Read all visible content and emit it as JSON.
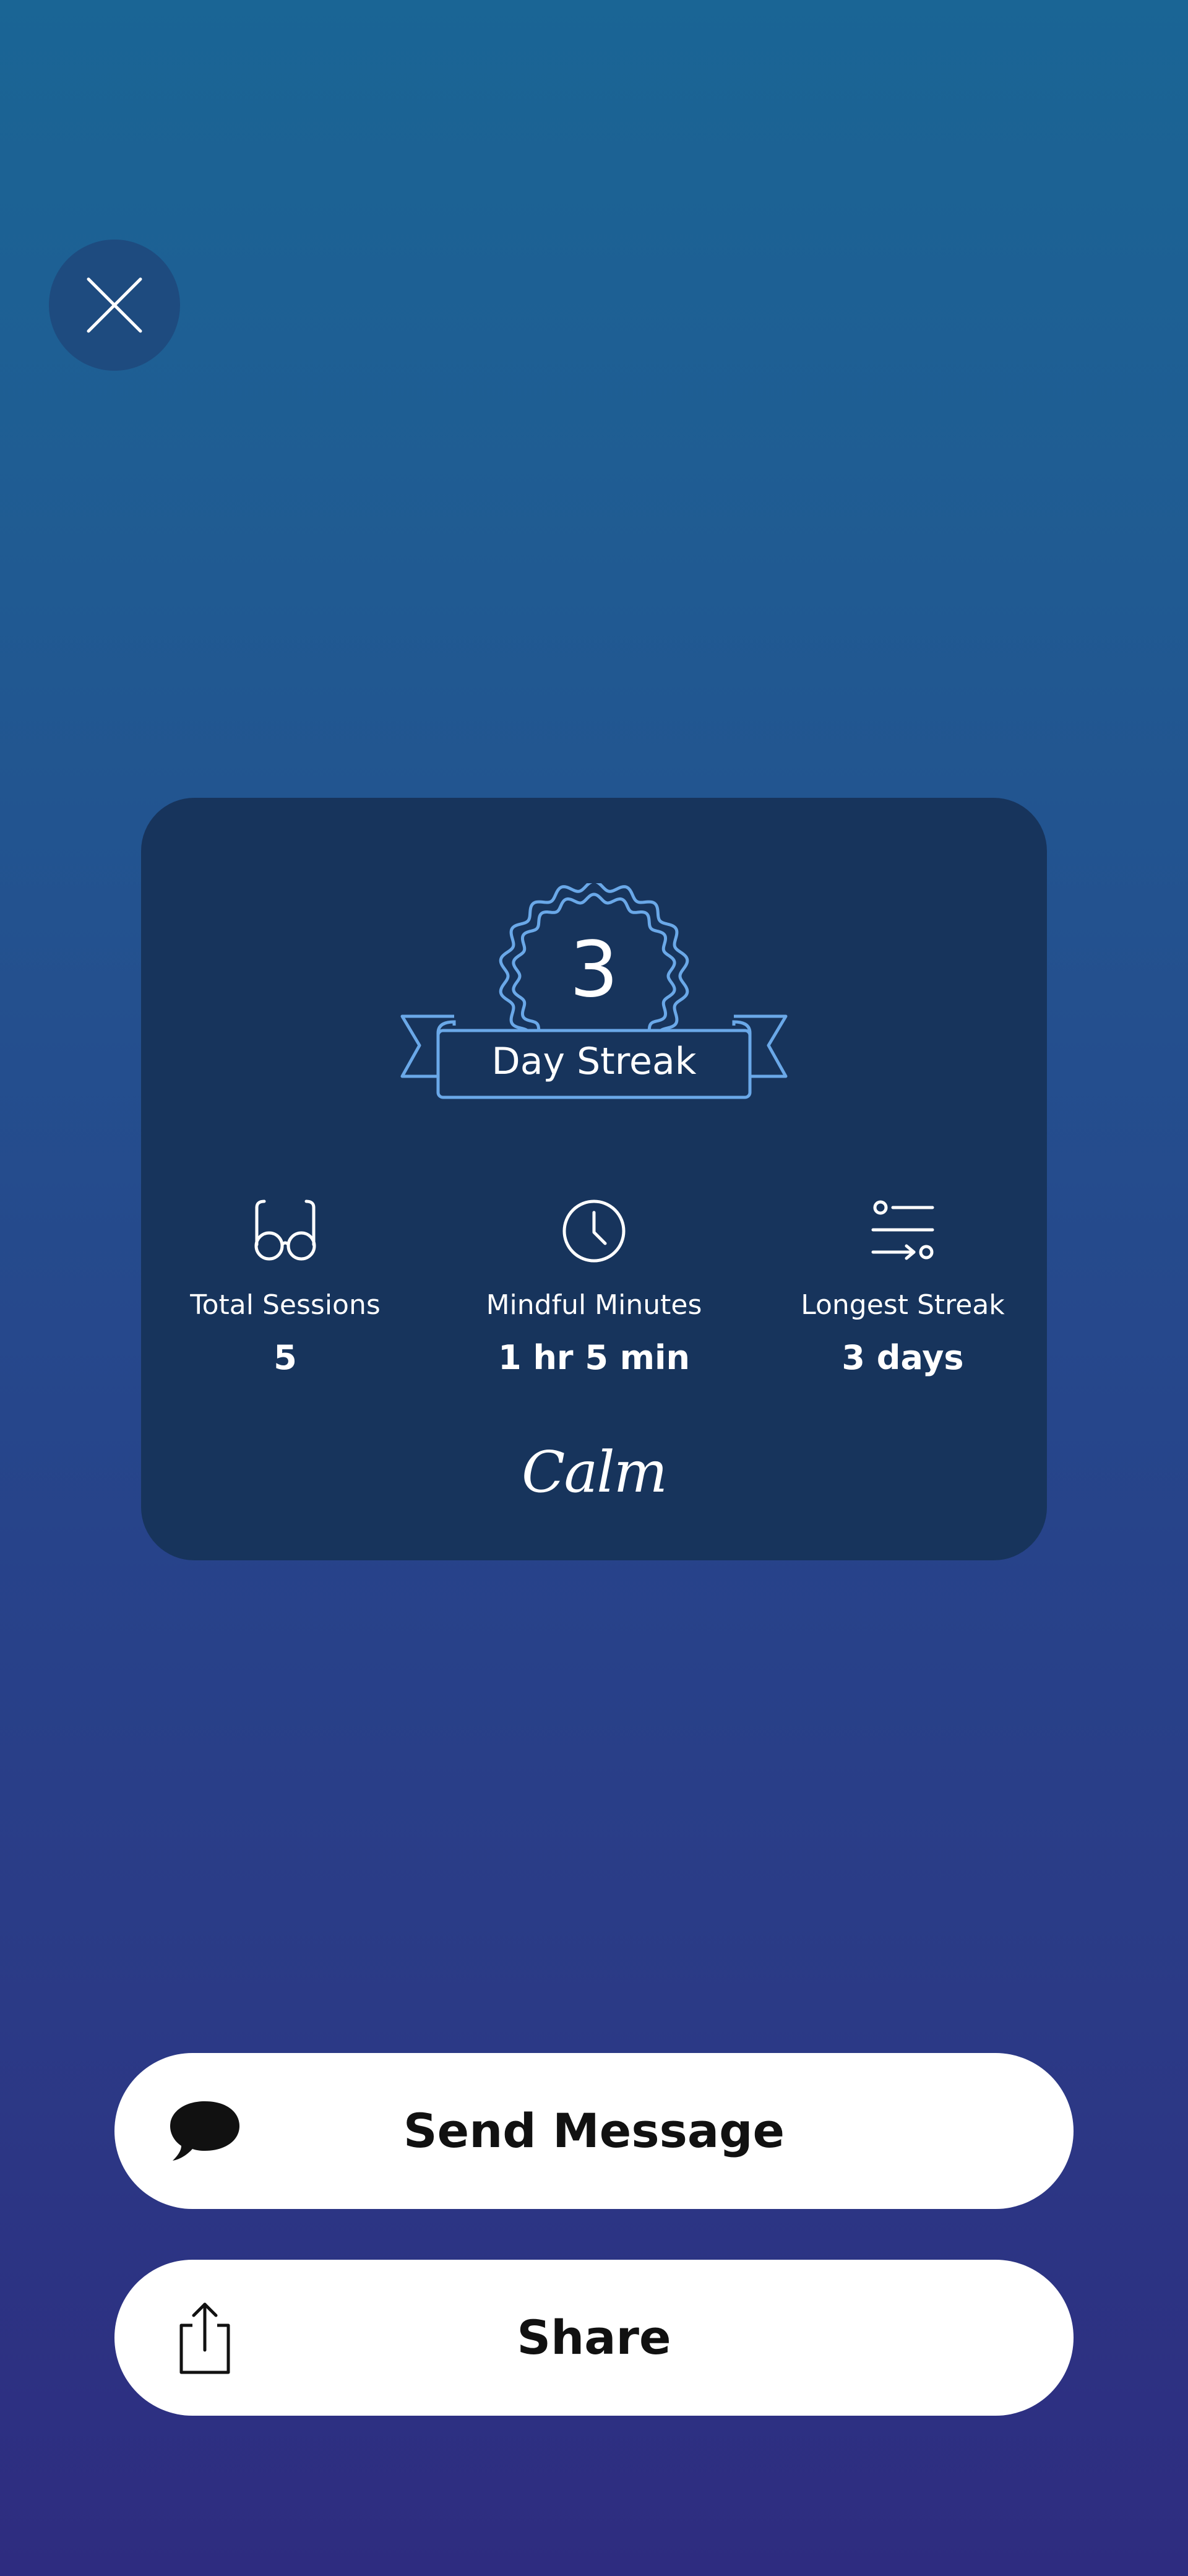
{
  "close": {
    "icon": "close-icon"
  },
  "card": {
    "badge": {
      "number": "3",
      "label": "Day Streak",
      "icon": "ribbon-badge-icon"
    },
    "stats": [
      {
        "icon": "glasses-icon",
        "label": "Total Sessions",
        "value": "5"
      },
      {
        "icon": "clock-icon",
        "label": "Mindful Minutes",
        "value": "1 hr 5 min"
      },
      {
        "icon": "sliders-icon",
        "label": "Longest Streak",
        "value": "3 days"
      }
    ],
    "logo": "Calm"
  },
  "actions": {
    "send_message": {
      "label": "Send Message",
      "icon": "speech-bubble-icon"
    },
    "share": {
      "label": "Share",
      "icon": "share-icon"
    }
  },
  "colors": {
    "background_top": "#1a6595",
    "background_bottom": "#2e2c80",
    "card": "#17345c",
    "badge_outline": "#6aa8e8",
    "button": "#ffffff"
  }
}
